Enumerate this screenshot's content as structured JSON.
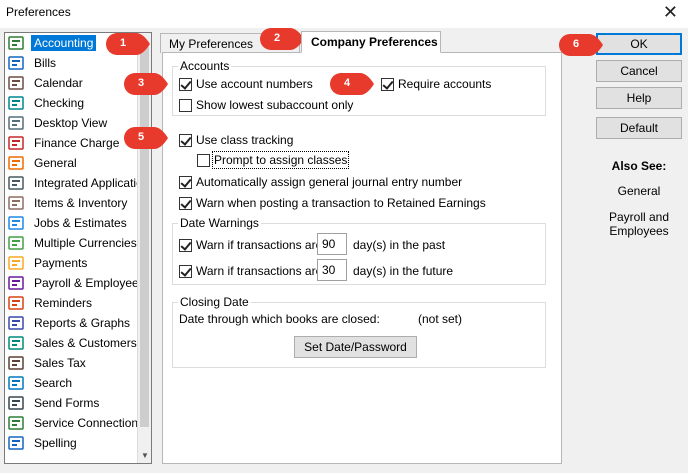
{
  "window": {
    "title": "Preferences",
    "close_glyph": "✕"
  },
  "sidebar": {
    "items": [
      {
        "label": "Accounting",
        "icon": "accounting-icon",
        "selected": true
      },
      {
        "label": "Bills",
        "icon": "bills-icon"
      },
      {
        "label": "Calendar",
        "icon": "calendar-icon"
      },
      {
        "label": "Checking",
        "icon": "checking-icon"
      },
      {
        "label": "Desktop View",
        "icon": "desktop-view-icon"
      },
      {
        "label": "Finance Charge",
        "icon": "finance-charge-icon"
      },
      {
        "label": "General",
        "icon": "general-icon"
      },
      {
        "label": "Integrated Applicatio",
        "icon": "integrated-applications-icon"
      },
      {
        "label": "Items & Inventory",
        "icon": "items-inventory-icon"
      },
      {
        "label": "Jobs & Estimates",
        "icon": "jobs-estimates-icon"
      },
      {
        "label": "Multiple Currencies",
        "icon": "multiple-currencies-icon"
      },
      {
        "label": "Payments",
        "icon": "payments-icon"
      },
      {
        "label": "Payroll & Employees",
        "icon": "payroll-employees-icon"
      },
      {
        "label": "Reminders",
        "icon": "reminders-icon"
      },
      {
        "label": "Reports & Graphs",
        "icon": "reports-graphs-icon"
      },
      {
        "label": "Sales & Customers",
        "icon": "sales-customers-icon"
      },
      {
        "label": "Sales Tax",
        "icon": "sales-tax-icon"
      },
      {
        "label": "Search",
        "icon": "search-icon"
      },
      {
        "label": "Send Forms",
        "icon": "send-forms-icon"
      },
      {
        "label": "Service Connection",
        "icon": "service-connection-icon"
      },
      {
        "label": "Spelling",
        "icon": "spelling-icon"
      }
    ]
  },
  "tabs": {
    "my_pref": "My Preferences",
    "company_pref": "Company Preferences"
  },
  "accounts": {
    "title": "Accounts",
    "use_account_numbers": "Use account numbers",
    "require_accounts": "Require accounts",
    "show_lowest": "Show lowest subaccount only"
  },
  "class": {
    "use_class_tracking": "Use class tracking",
    "prompt_assign": "Prompt to assign classes"
  },
  "auto_assign": "Automatically assign general journal entry number",
  "warn_retained": "Warn when posting a transaction to Retained Earnings",
  "date_warnings": {
    "title": "Date Warnings",
    "past_label_pre": "Warn if transactions are",
    "past_value": "90",
    "past_label_post": "day(s) in the past",
    "future_label_pre": "Warn if transactions are",
    "future_value": "30",
    "future_label_post": "day(s) in the future"
  },
  "closing": {
    "title": "Closing Date",
    "through_label": "Date through which books are closed:",
    "status": "(not set)",
    "set_button": "Set Date/Password"
  },
  "buttons": {
    "ok": "OK",
    "cancel": "Cancel",
    "help": "Help",
    "default": "Default"
  },
  "also_see": {
    "title": "Also See:",
    "links": [
      "General",
      "Payroll and Employees"
    ]
  },
  "callouts": [
    "1",
    "2",
    "3",
    "4",
    "5",
    "6"
  ],
  "colors": {
    "selection": "#0078d7",
    "callout": "#e8392d"
  }
}
